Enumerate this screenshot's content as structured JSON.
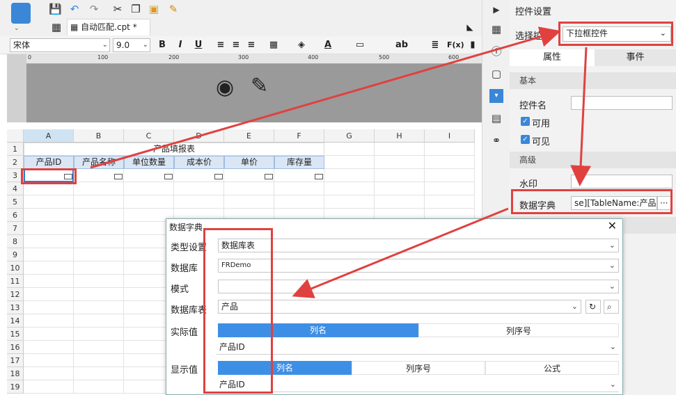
{
  "file_tab": "自动匹配.cpt *",
  "format_bar": {
    "font": "宋体",
    "size": "9.0",
    "bold": "B",
    "italic": "I",
    "underline": "U",
    "fx": "F(x)",
    "ab": "ab"
  },
  "ruler": {
    "labels": [
      "0",
      "100",
      "200",
      "300",
      "400",
      "500",
      "600"
    ]
  },
  "grid": {
    "columns": [
      "A",
      "B",
      "C",
      "D",
      "E",
      "F",
      "G",
      "H",
      "I"
    ],
    "rows": [
      "1",
      "2",
      "3",
      "4",
      "5",
      "6",
      "7",
      "8",
      "9",
      "10",
      "11",
      "12",
      "13",
      "14",
      "15",
      "16",
      "17",
      "18",
      "19"
    ],
    "title": "产品填报表",
    "headers": [
      "产品ID",
      "产品名称",
      "单位数量",
      "成本价",
      "单价",
      "库存量"
    ]
  },
  "panel": {
    "title": "控件设置",
    "select_label": "选择控件",
    "select_value": "下拉框控件",
    "tab_attr": "属性",
    "tab_event": "事件",
    "sec_basic": "基本",
    "name_label": "控件名",
    "name_value": "",
    "enabled_label": "可用",
    "visible_label": "可见",
    "sec_adv": "高级",
    "watermark_label": "水印",
    "dict_label": "数据字典",
    "dict_value": "se][TableName:产品]",
    "more": "···"
  },
  "dialog": {
    "title": "数据字典",
    "type_label": "类型设置",
    "type_value": "数据库表",
    "db_label": "数据库",
    "db_value": "FRDemo",
    "mode_label": "模式",
    "mode_value": "",
    "table_label": "数据库表",
    "table_value": "产品",
    "actual_label": "实际值",
    "actual_seg": [
      "列名",
      "列序号"
    ],
    "actual_value": "产品ID",
    "display_label": "显示值",
    "display_seg": [
      "列名",
      "列序号",
      "公式"
    ],
    "display_value": "产品ID"
  },
  "colors": {
    "accent": "#3d8fe6",
    "highlight": "#e0413f"
  }
}
